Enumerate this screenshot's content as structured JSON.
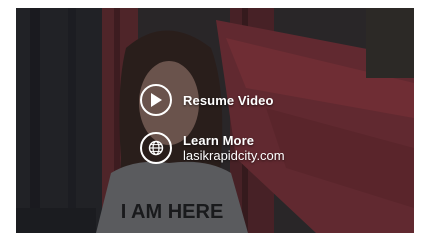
{
  "overlay": {
    "resume": {
      "label": "Resume Video",
      "icon": "play-icon"
    },
    "learn_more": {
      "label": "Learn More",
      "url_text": "lasikrapidcity.com",
      "icon": "globe-icon"
    }
  },
  "video": {
    "shirt_text": "I AM HERE"
  },
  "colors": {
    "overlay_text": "#ffffff",
    "slide_red": "#b2404a",
    "background": "#2b2a2b"
  }
}
